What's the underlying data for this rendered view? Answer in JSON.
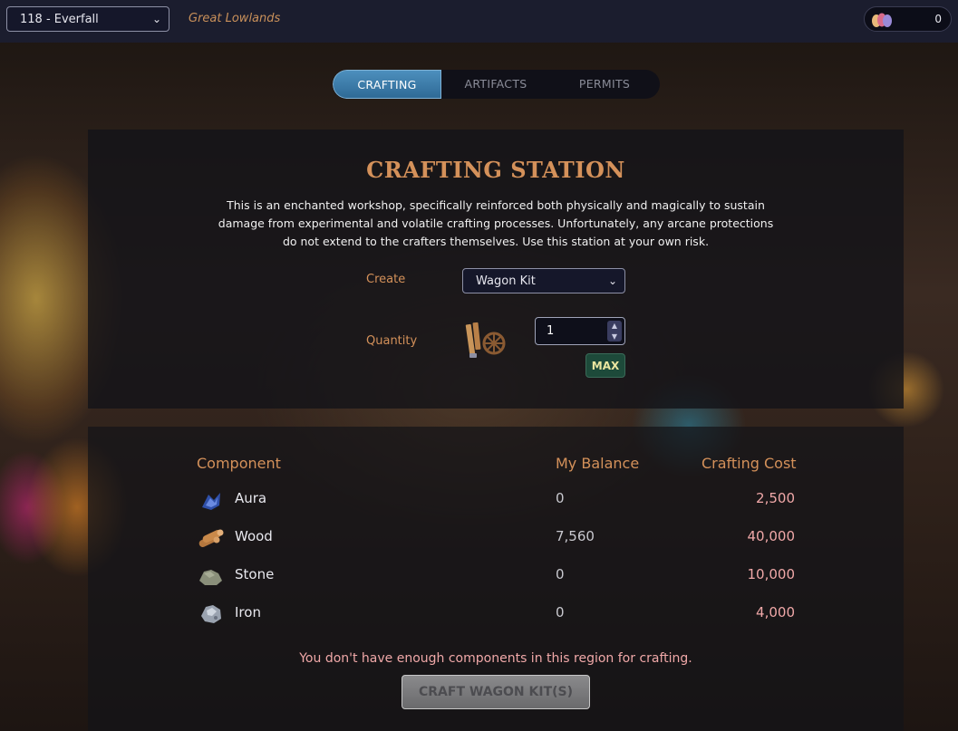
{
  "topbar": {
    "region_select": "118 - Everfall",
    "region_name": "Great Lowlands",
    "wallet_count": "0"
  },
  "tabs": [
    {
      "label": "CRAFTING",
      "active": true
    },
    {
      "label": "ARTIFACTS",
      "active": false
    },
    {
      "label": "PERMITS",
      "active": false
    }
  ],
  "station": {
    "title": "CRAFTING STATION",
    "description": "This is an enchanted workshop, specifically reinforced both physically and magically to sustain damage from experimental and volatile crafting processes. Unfortunately, any arcane protections do not extend to the crafters themselves. Use this station at your own risk.",
    "create_label": "Create",
    "create_value": "Wagon Kit",
    "quantity_label": "Quantity",
    "quantity_value": "1",
    "max_label": "MAX"
  },
  "table": {
    "headers": {
      "component": "Component",
      "balance": "My Balance",
      "cost": "Crafting Cost"
    },
    "rows": [
      {
        "name": "Aura",
        "balance": "0",
        "cost": "2,500",
        "icon": "aura-icon"
      },
      {
        "name": "Wood",
        "balance": "7,560",
        "cost": "40,000",
        "icon": "wood-icon"
      },
      {
        "name": "Stone",
        "balance": "0",
        "cost": "10,000",
        "icon": "stone-icon"
      },
      {
        "name": "Iron",
        "balance": "0",
        "cost": "4,000",
        "icon": "iron-icon"
      }
    ]
  },
  "warning": "You don't have enough components in this region for crafting.",
  "craft_button": "CRAFT WAGON KIT(S)",
  "colors": {
    "accent": "#d4915a",
    "tab_active": "#3f7eab",
    "cost": "#f0a8a8"
  }
}
